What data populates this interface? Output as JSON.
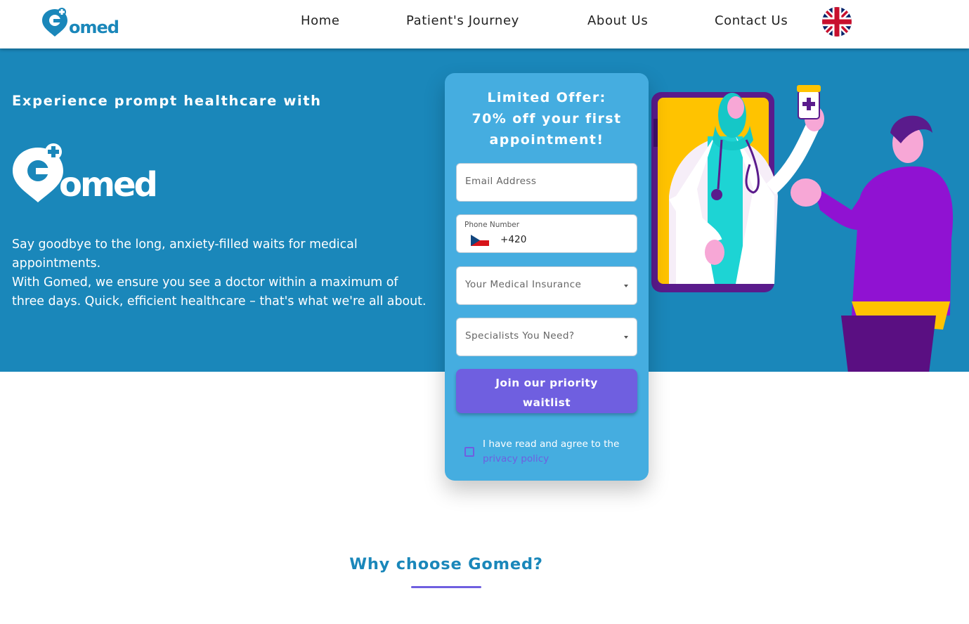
{
  "brand": {
    "name": "Gomed",
    "primary_color": "#1a87ba",
    "accent_color": "#6f5fe0",
    "card_color": "#45ade0"
  },
  "header": {
    "nav": [
      {
        "label": "Home"
      },
      {
        "label": "Patient's Journey"
      },
      {
        "label": "About Us"
      },
      {
        "label": "Contact Us"
      }
    ],
    "language_icon": "uk-flag-icon"
  },
  "hero": {
    "heading": "Experience prompt healthcare with",
    "description_line1": "Say goodbye to the long, anxiety-filled waits for medical appointments.",
    "description_line2": "With Gomed, we ensure you see a doctor within a maximum of three days. Quick, efficient healthcare – that's what we're all about."
  },
  "offer_form": {
    "title_line1": "Limited Offer:",
    "title_line2": "70% off your first",
    "title_line3": "appointment!",
    "email_placeholder": "Email Address",
    "phone_label": "Phone Number",
    "phone_code": "+420",
    "phone_country_icon": "czech-flag-icon",
    "insurance_placeholder": "Your Medical Insurance",
    "specialists_placeholder": "Specialists You Need?",
    "submit_line1": "Join our priority",
    "submit_line2": "waitlist",
    "agree_text": "I have read and agree to the",
    "privacy_link": "privacy policy"
  },
  "why_section": {
    "title": "Why choose Gomed?"
  }
}
